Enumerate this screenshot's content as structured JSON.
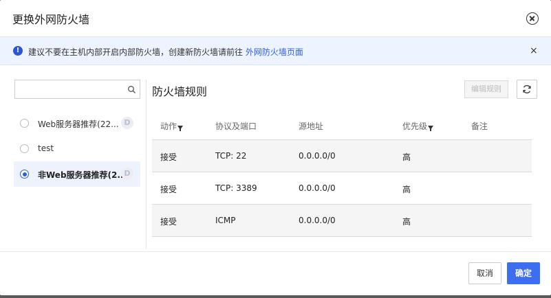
{
  "dialog": {
    "title": "更换外网防火墙",
    "close_icon": "circle-close-icon"
  },
  "notice": {
    "icon": "info-icon",
    "icon_glyph": "!",
    "text": "建议不要在主机内部开启内部防火墙，创建新防火墙请前往 ",
    "link": "外网防火墙页面",
    "close_glyph": "×"
  },
  "search": {
    "placeholder": "",
    "value": "",
    "icon": "search-icon"
  },
  "groups": [
    {
      "name": "Web服务器推荐(22...",
      "badge": "D",
      "selected": false
    },
    {
      "name": "test",
      "badge": "",
      "selected": false
    },
    {
      "name": "非Web服务器推荐(2...",
      "badge": "D",
      "selected": true
    }
  ],
  "rules": {
    "title": "防火墙规则",
    "edit_button": "编辑规则",
    "refresh_icon": "refresh-icon",
    "columns": [
      "动作",
      "协议及端口",
      "源地址",
      "优先级",
      "备注"
    ],
    "rows": [
      {
        "action": "接受",
        "protocol": "TCP: 22",
        "source": "0.0.0.0/0",
        "priority": "高",
        "remark": ""
      },
      {
        "action": "接受",
        "protocol": "TCP: 3389",
        "source": "0.0.0.0/0",
        "priority": "高",
        "remark": ""
      },
      {
        "action": "接受",
        "protocol": "ICMP",
        "source": "0.0.0.0/0",
        "priority": "高",
        "remark": ""
      }
    ]
  },
  "footer": {
    "cancel": "取消",
    "confirm": "确定"
  },
  "colors": {
    "accent": "#3d6ef0",
    "link": "#2b5ee8",
    "notice_bg": "#eef4ff",
    "selected_bg": "#edf2fd"
  }
}
